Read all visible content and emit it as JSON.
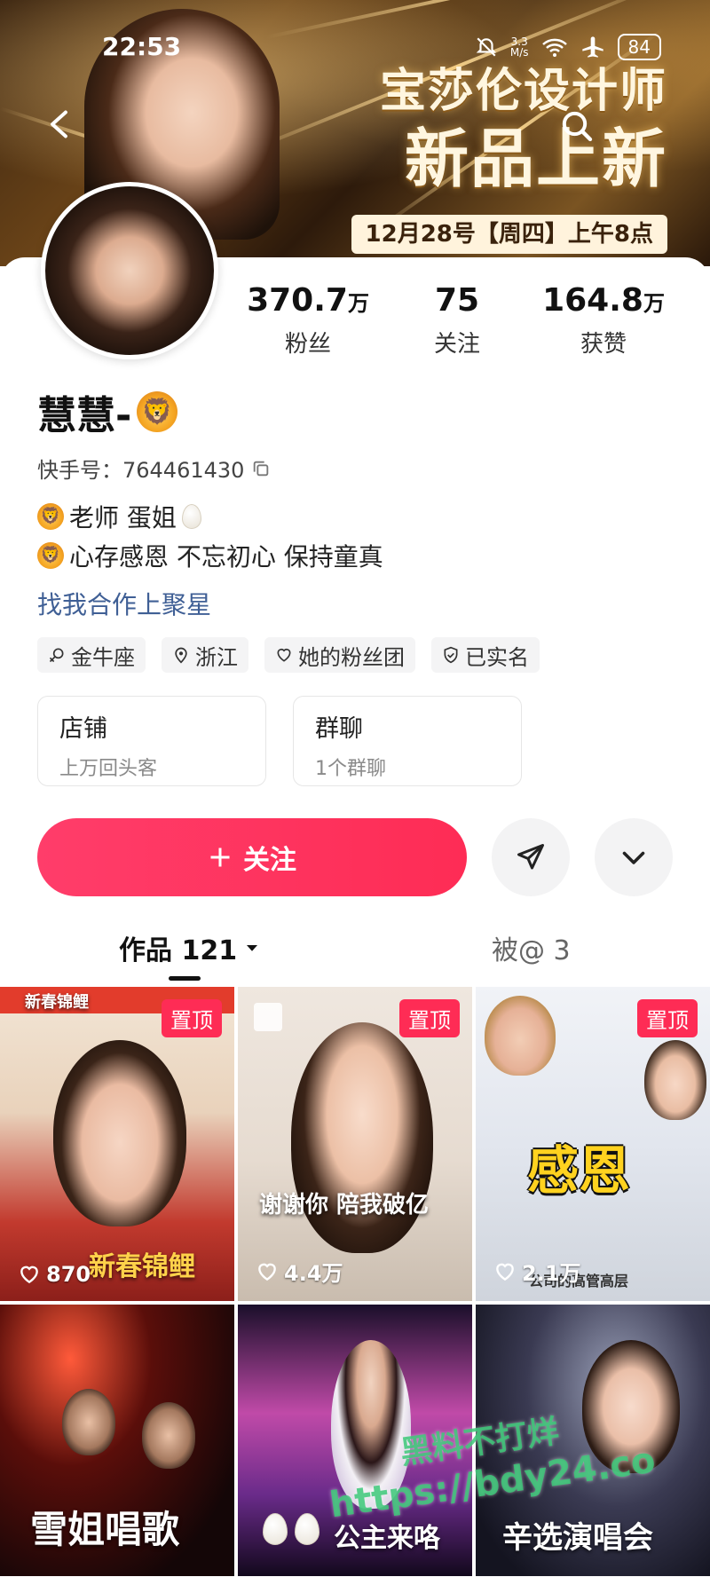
{
  "status_bar": {
    "time": "22:53",
    "speed_top": "3.3",
    "speed_unit": "M/s",
    "battery": "84"
  },
  "banner": {
    "title_line1": "宝莎伦设计师",
    "title_line2": "新品上新",
    "date": "12月28号【周四】上午8点"
  },
  "profile": {
    "name": "慧慧-",
    "uid_label": "快手号：764461430",
    "stats": [
      {
        "value": "370.7",
        "unit": "万",
        "label": "粉丝"
      },
      {
        "value": "75",
        "unit": "",
        "label": "关注"
      },
      {
        "value": "164.8",
        "unit": "万",
        "label": "获赞"
      }
    ],
    "bio_line1": "老师 蛋姐",
    "bio_line2": "心存感恩 不忘初心 保持童真",
    "cooperate_link": "找我合作上聚星",
    "tags": [
      "金牛座",
      "浙江",
      "她的粉丝团",
      "已实名"
    ],
    "entries": [
      {
        "title": "店铺",
        "sub": "上万回头客"
      },
      {
        "title": "群聊",
        "sub": "1个群聊"
      }
    ],
    "follow_label": "关注"
  },
  "tabs": {
    "works": "作品 121",
    "mentioned": "被@ 3"
  },
  "videos": [
    {
      "pinned": "置顶",
      "likes": "870",
      "caption": "新春锦鲤",
      "top_text": "新春锦鲤"
    },
    {
      "pinned": "置顶",
      "likes": "4.4万",
      "caption": "谢谢你 陪我破亿"
    },
    {
      "pinned": "置顶",
      "likes": "2.1万",
      "caption": "感恩",
      "sub_caption": "公司的高管高层"
    },
    {
      "caption": "雪姐唱歌"
    },
    {
      "caption": "公主来咯"
    },
    {
      "caption": "辛选演唱会"
    }
  ],
  "watermark": {
    "line1": "黑料不打烊",
    "line2": "https://bdy24.co"
  },
  "colors": {
    "accent": "#fe2c55",
    "link": "#3f5f95"
  }
}
